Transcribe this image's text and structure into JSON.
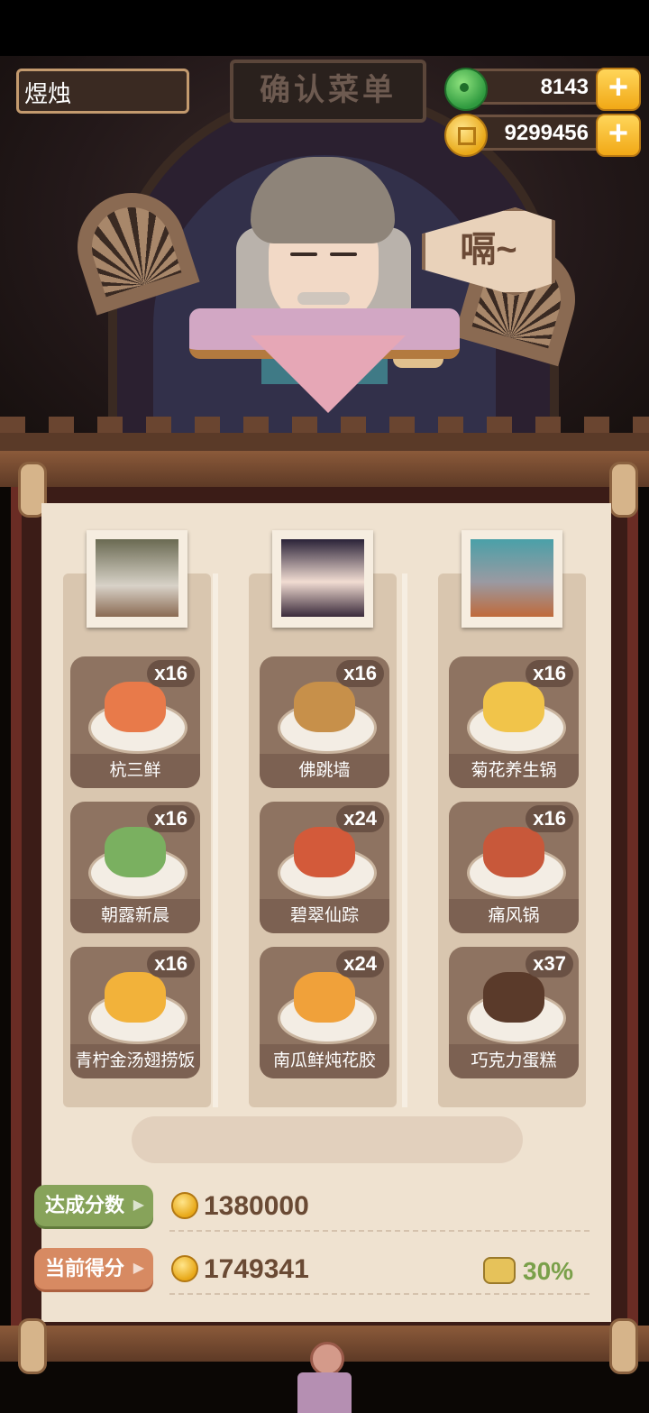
{
  "header": {
    "player_name": "煜烛",
    "title": "确认菜单",
    "speech": "嗝~"
  },
  "currency": {
    "jade": {
      "icon": "jade-coin-icon",
      "value": "8143"
    },
    "coins": {
      "icon": "gold-coin-icon",
      "value": "9299456"
    },
    "add_symbol": "+"
  },
  "columns": [
    {
      "avatar": "white-hair-girl-avatar",
      "dishes": [
        {
          "name": "杭三鲜",
          "count": "x16",
          "color": "#e87a4a"
        },
        {
          "name": "朝露新晨",
          "count": "x16",
          "color": "#7ab060"
        },
        {
          "name": "青柠金汤翅捞饭",
          "count": "x16",
          "color": "#f2b23a"
        }
      ]
    },
    {
      "avatar": "purple-hair-girl-avatar",
      "dishes": [
        {
          "name": "佛跳墙",
          "count": "x16",
          "color": "#c7904a"
        },
        {
          "name": "碧翠仙踪",
          "count": "x24",
          "color": "#d35a3a"
        },
        {
          "name": "南瓜鲜炖花胶",
          "count": "x24",
          "color": "#f0a13a"
        }
      ]
    },
    {
      "avatar": "wolf-soldier-avatar",
      "dishes": [
        {
          "name": "菊花养生锅",
          "count": "x16",
          "color": "#f1c44a"
        },
        {
          "name": "痛风锅",
          "count": "x16",
          "color": "#c8583a"
        },
        {
          "name": "巧克力蛋糕",
          "count": "x37",
          "color": "#5a3a2a"
        }
      ]
    }
  ],
  "scores": {
    "target_label": "达成分数",
    "target_value": "1380000",
    "current_label": "当前得分",
    "current_value": "1749341",
    "bonus_percent": "30%"
  },
  "colors": {
    "accent_gold": "#f1a816",
    "panel_paper": "#efe2d0",
    "card_brown": "#8e7361",
    "target_green": "#87a35a",
    "current_orange": "#d78a62"
  }
}
